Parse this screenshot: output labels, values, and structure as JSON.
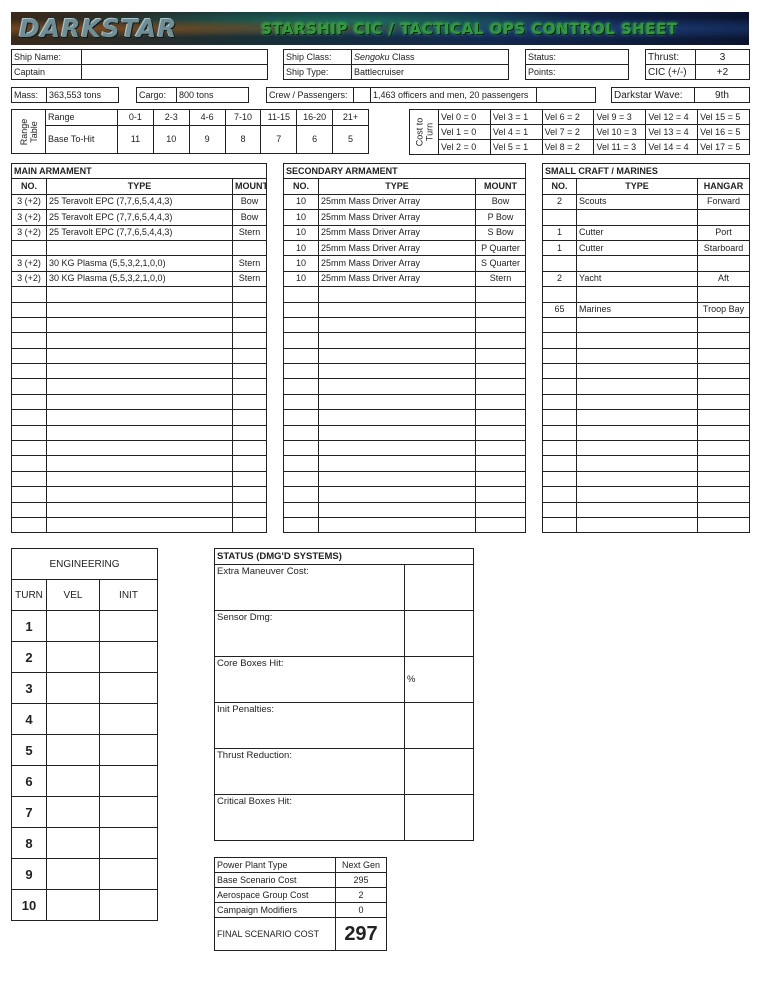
{
  "banner": {
    "logo": "DARKSTAR",
    "subtitle": "STARSHIP CIC / TACTICAL OPS CONTROL SHEET"
  },
  "ship_info": {
    "ship_name_label": "Ship Name:",
    "ship_name_value": "",
    "captain_label": "Captain",
    "captain_value": "",
    "ship_class_label": "Ship Class:",
    "ship_class_italic": "Sengoku",
    "ship_class_suffix": " Class",
    "ship_type_label": "Ship Type:",
    "ship_type_value": "Battlecruiser",
    "status_label": "Status:",
    "status_value": "",
    "points_label": "Points:",
    "points_value": "",
    "thrust_label": "Thrust:",
    "thrust_value": "3",
    "cic_label": "CIC (+/-)",
    "cic_value": "+2"
  },
  "stats": {
    "mass_label": "Mass:",
    "mass_value": "363,553 tons",
    "cargo_label": "Cargo:",
    "cargo_value": "800 tons",
    "crew_label": "Crew / Passengers:",
    "crew_value": "1,463 officers and men, 20 passengers",
    "wave_label": "Darkstar Wave:",
    "wave_value": "9th"
  },
  "range_table": {
    "side_label_1": "Range",
    "side_label_2": "Table",
    "row1_label": "Range",
    "row2_label": "Base To-Hit",
    "ranges": [
      "0-1",
      "2-3",
      "4-6",
      "7-10",
      "11-15",
      "16-20",
      "21+"
    ],
    "to_hit": [
      "11",
      "10",
      "9",
      "8",
      "7",
      "6",
      "5"
    ]
  },
  "cost_to_turn": {
    "side_label_1": "Cost to",
    "side_label_2": "Turn",
    "rows": [
      [
        "Vel 0 = 0",
        "Vel 3 = 1",
        "Vel 6 = 2",
        "Vel 9 = 3",
        "Vel 12 = 4",
        "Vel 15 = 5"
      ],
      [
        "Vel 1 = 0",
        "Vel 4 = 1",
        "Vel 7 = 2",
        "Vel 10 = 3",
        "Vel 13 = 4",
        "Vel 16 = 5"
      ],
      [
        "Vel 2 = 0",
        "Vel 5 = 1",
        "Vel 8 = 2",
        "Vel 11 = 3",
        "Vel 14 = 4",
        "Vel 17 = 5"
      ]
    ]
  },
  "main_armament": {
    "title": "MAIN ARMAMENT",
    "headers": [
      "NO.",
      "TYPE",
      "MOUNT"
    ],
    "rows": [
      [
        "3 (+2)",
        "25 Teravolt EPC (7,7,6,5,4,4,3)",
        "Bow"
      ],
      [
        "3 (+2)",
        "25 Teravolt EPC (7,7,6,5,4,4,3)",
        "Bow"
      ],
      [
        "3 (+2)",
        "25 Teravolt EPC (7,7,6,5,4,4,3)",
        "Stern"
      ],
      [
        "",
        "",
        ""
      ],
      [
        "3 (+2)",
        "30 KG Plasma (5,5,3,2,1,0,0)",
        "Stern"
      ],
      [
        "3 (+2)",
        "30 KG Plasma (5,5,3,2,1,0,0)",
        "Stern"
      ]
    ]
  },
  "secondary_armament": {
    "title": "SECONDARY ARMAMENT",
    "headers": [
      "NO.",
      "TYPE",
      "MOUNT"
    ],
    "rows": [
      [
        "10",
        "25mm Mass Driver Array",
        "Bow"
      ],
      [
        "10",
        "25mm Mass Driver Array",
        "P Bow"
      ],
      [
        "10",
        "25mm Mass Driver Array",
        "S Bow"
      ],
      [
        "10",
        "25mm Mass Driver Array",
        "P Quarter"
      ],
      [
        "10",
        "25mm Mass Driver Array",
        "S Quarter"
      ],
      [
        "10",
        "25mm Mass Driver Array",
        "Stern"
      ]
    ]
  },
  "small_craft": {
    "title": "SMALL CRAFT / MARINES",
    "headers": [
      "NO.",
      "TYPE",
      "HANGAR"
    ],
    "rows": [
      [
        "2",
        "Scouts",
        "Forward"
      ],
      [
        "",
        "",
        ""
      ],
      [
        "1",
        "Cutter",
        "Port"
      ],
      [
        "1",
        "Cutter",
        "Starboard"
      ],
      [
        "",
        "",
        ""
      ],
      [
        "2",
        "Yacht",
        "Aft"
      ],
      [
        "",
        "",
        ""
      ],
      [
        "65",
        "Marines",
        "Troop Bay"
      ]
    ]
  },
  "engineering": {
    "title": "ENGINEERING",
    "headers": [
      "TURN",
      "VEL",
      "INIT"
    ],
    "turns": [
      "1",
      "2",
      "3",
      "4",
      "5",
      "6",
      "7",
      "8",
      "9",
      "10"
    ]
  },
  "status": {
    "title": "STATUS (DMG'D SYSTEMS)",
    "rows": [
      {
        "label": "Extra Maneuver Cost:",
        "value": ""
      },
      {
        "label": "Sensor Dmg:",
        "value": ""
      },
      {
        "label": "Core Boxes Hit:",
        "value": "%"
      },
      {
        "label": "Init Penalties:",
        "value": ""
      },
      {
        "label": "Thrust Reduction:",
        "value": ""
      },
      {
        "label": "Critical Boxes Hit:",
        "value": ""
      }
    ]
  },
  "cost": {
    "rows": [
      {
        "label": "Power Plant Type",
        "value": "Next Gen"
      },
      {
        "label": "Base Scenario Cost",
        "value": "295"
      },
      {
        "label": "Aerospace Group Cost",
        "value": "2"
      },
      {
        "label": "Campaign Modifiers",
        "value": "0"
      }
    ],
    "final_label": "FINAL SCENARIO COST",
    "final_value": "297"
  }
}
